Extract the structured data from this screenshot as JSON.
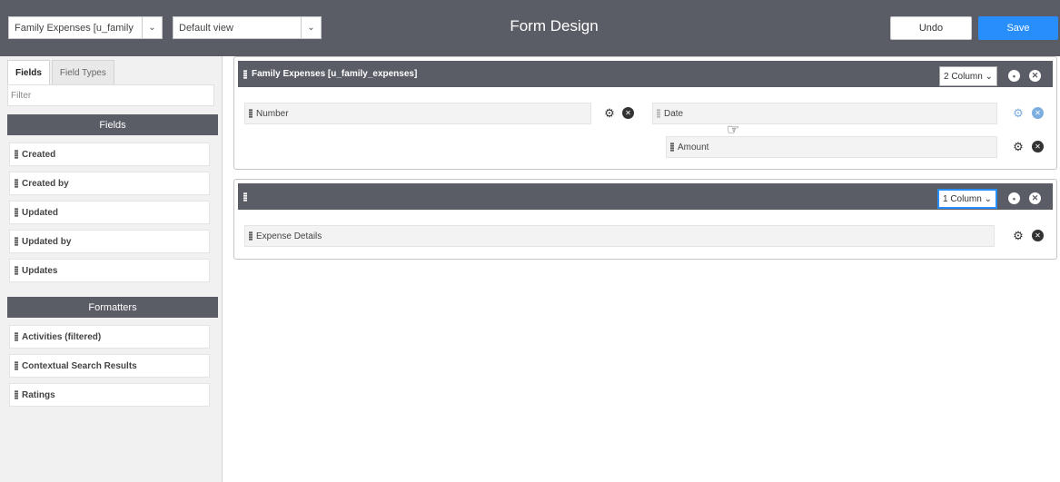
{
  "header": {
    "table_select": "Family Expenses [u_family",
    "view_select": "Default view",
    "title": "Form Design",
    "undo_label": "Undo",
    "save_label": "Save"
  },
  "sidebar": {
    "tabs": [
      "Fields",
      "Field Types"
    ],
    "filter_placeholder": "Filter",
    "fields_heading": "Fields",
    "fields": [
      "Created",
      "Created by",
      "Updated",
      "Updated by",
      "Updates"
    ],
    "formatters_heading": "Formatters",
    "formatters": [
      "Activities (filtered)",
      "Contextual Search Results",
      "Ratings"
    ]
  },
  "sections": [
    {
      "title": "Family Expenses [u_family_expenses]",
      "columns": "2 Column",
      "left_fields": [
        "Number"
      ],
      "right_fields": [
        "Date",
        "Amount"
      ]
    },
    {
      "title": "",
      "columns": "1 Column",
      "fields": [
        "Expense Details"
      ]
    }
  ],
  "colors": {
    "header_bg": "#5a5c66",
    "save_bg": "#278efc",
    "highlight": "#7eaee0"
  }
}
